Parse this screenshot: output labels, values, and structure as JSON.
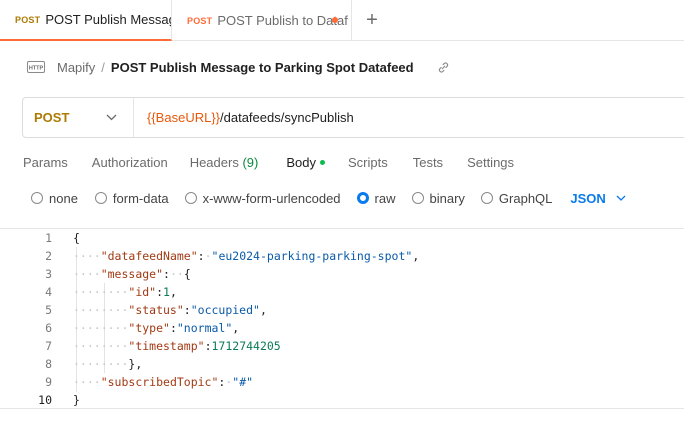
{
  "tabs": [
    {
      "method": "POST",
      "name": "POST Publish Message",
      "active": true
    },
    {
      "method": "POST",
      "name": "POST Publish to Dataf",
      "unsaved": true
    }
  ],
  "new_tab_label": "+",
  "breadcrumb": {
    "icon": "http-icon",
    "parent": "Mapify",
    "separator": "/",
    "title": "POST Publish Message to Parking Spot Datafeed"
  },
  "request": {
    "method": "POST",
    "url_variable": "{{BaseURL}}",
    "url_path": "/datafeeds/syncPublish"
  },
  "request_tabs": [
    {
      "label": "Params"
    },
    {
      "label": "Authorization"
    },
    {
      "label": "Headers",
      "count": "(9)"
    },
    {
      "label": "Body",
      "active": true
    },
    {
      "label": "Scripts"
    },
    {
      "label": "Tests"
    },
    {
      "label": "Settings"
    }
  ],
  "body_modes": [
    {
      "label": "none",
      "checked": false
    },
    {
      "label": "form-data",
      "checked": false
    },
    {
      "label": "x-www-form-urlencoded",
      "checked": false
    },
    {
      "label": "raw",
      "checked": true
    },
    {
      "label": "binary",
      "checked": false
    },
    {
      "label": "GraphQL",
      "checked": false
    }
  ],
  "raw_language": "JSON",
  "editor": {
    "current_line": 10,
    "line_numbers": [
      "1",
      "2",
      "3",
      "4",
      "5",
      "6",
      "7",
      "8",
      "9",
      "10"
    ],
    "lines": {
      "l1_open": "{",
      "l2_key": "\"datafeedName\"",
      "l2_colon": ":",
      "l2_val": "\"eu2024-parking-parking-spot\"",
      "l2_comma": ",",
      "l3_key": "\"message\"",
      "l3_colon": ":",
      "l3_open": "{",
      "l4_key": "\"id\"",
      "l4_colon": ":",
      "l4_val": "1",
      "l4_comma": ",",
      "l5_key": "\"status\"",
      "l5_colon": ":",
      "l5_val": "\"occupied\"",
      "l5_comma": ",",
      "l6_key": "\"type\"",
      "l6_colon": ":",
      "l6_val": "\"normal\"",
      "l6_comma": ",",
      "l7_key": "\"timestamp\"",
      "l7_colon": ":",
      "l7_val": "1712744205",
      "l8_close": "},",
      "l9_key": "\"subscribedTopic\"",
      "l9_colon": ":",
      "l9_val": "\"#\"",
      "l10_close": "}"
    }
  },
  "colors": {
    "accent_orange": "#ff6c37",
    "post_method": "#ad7a03",
    "active_blue": "#097bed",
    "body_dot_green": "#0cbb52",
    "json_key": "#a33a14",
    "json_string": "#0a5aa8",
    "json_number": "#0b7a55"
  }
}
